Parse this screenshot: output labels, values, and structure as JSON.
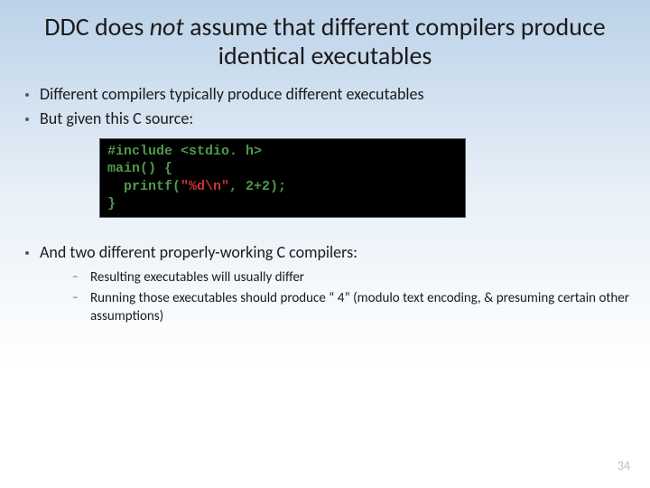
{
  "title": {
    "pre": "DDC does ",
    "em": "not",
    "post": " assume that different compilers produce identical executables"
  },
  "bullets": {
    "b1": "Different compilers typically produce different executables",
    "b2": "But given this C source:",
    "b3": "And two different properly-working C compilers:"
  },
  "code": {
    "l1": "#include <stdio. h>",
    "l2": "main() {",
    "l3a": "  printf(",
    "l3str": "\"%d\\n\"",
    "l3b": ", 2+2);",
    "l4": "}"
  },
  "sub": {
    "s1": "Resulting executables will usually differ",
    "s2": "Running those executables should produce “ 4” (modulo text encoding, & presuming certain other assumptions)"
  },
  "pagenum": "34",
  "chart_data": null
}
